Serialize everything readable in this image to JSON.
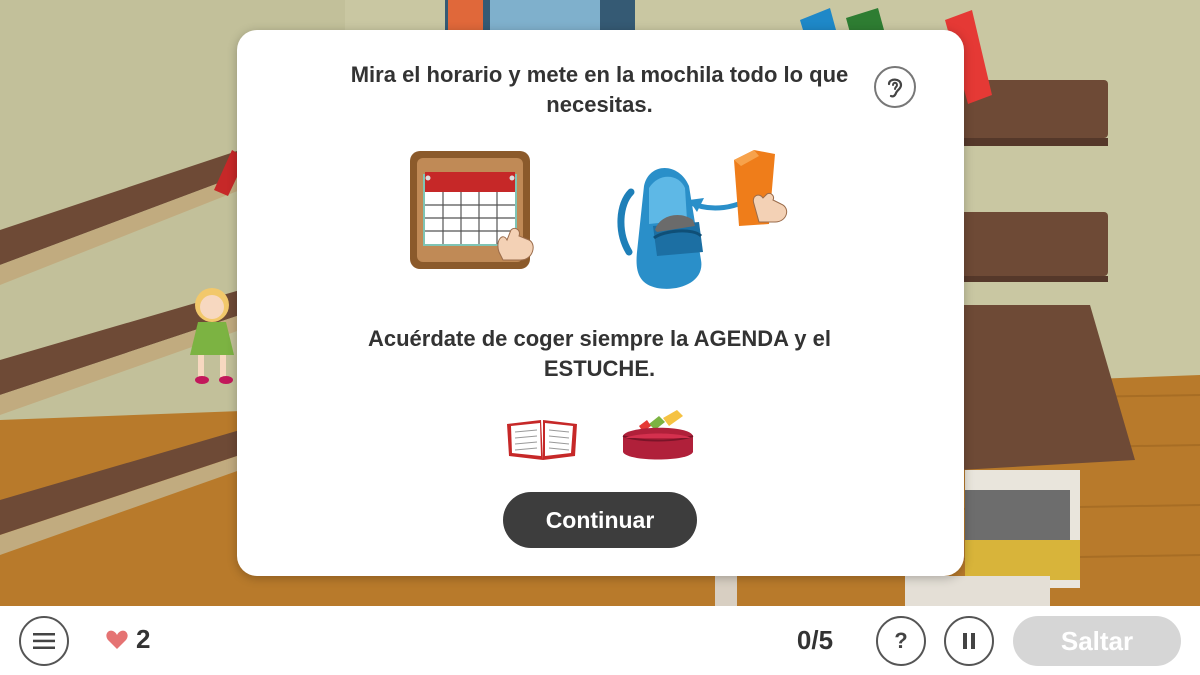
{
  "modal": {
    "instruction_1": "Mira el horario y mete en la mochila todo lo que necesitas.",
    "instruction_2": "Acuérdate de coger siempre la AGENDA y el ESTUCHE.",
    "continue_label": "Continuar"
  },
  "bottom_bar": {
    "lives": "2",
    "progress": "0/5",
    "help_label": "?",
    "skip_label": "Saltar"
  },
  "icons": {
    "menu": "menu-icon",
    "heart": "heart-icon",
    "ear": "ear-icon",
    "pause": "pause-icon"
  },
  "colors": {
    "continue_button": "#3d3d3d",
    "skip_button_disabled": "#d6d6d6",
    "heart": "#e57373",
    "wall": "#c9c7a2",
    "shelf": "#6e4a36",
    "floor": "#b87a2b"
  }
}
